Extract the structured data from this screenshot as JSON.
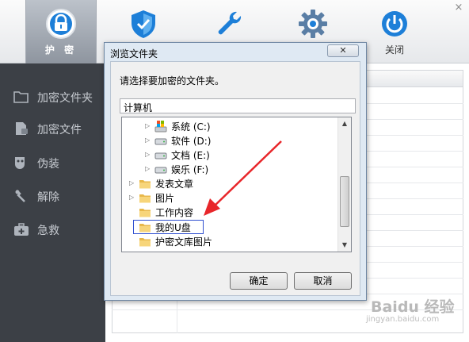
{
  "toolbar": {
    "protect_label": "护 密",
    "shield_label": "",
    "tools_label": "工具",
    "settings_label": "设置",
    "close_label": "关闭",
    "window_close": "×"
  },
  "sidebar": {
    "items": [
      {
        "label": "加密文件夹",
        "icon": "folder-icon"
      },
      {
        "label": "加密文件",
        "icon": "file-icon"
      },
      {
        "label": "伪装",
        "icon": "disguise-icon"
      },
      {
        "label": "解除",
        "icon": "unlock-icon"
      },
      {
        "label": "急救",
        "icon": "first-aid-icon"
      }
    ]
  },
  "dialog": {
    "title": "浏览文件夹",
    "close": "✕",
    "prompt": "请选择要加密的文件夹。",
    "path": "计算机",
    "tree": [
      {
        "label": "系统 (C:)",
        "icon": "system-drive-icon"
      },
      {
        "label": "软件 (D:)",
        "icon": "drive-icon"
      },
      {
        "label": "文档 (E:)",
        "icon": "drive-icon"
      },
      {
        "label": "娱乐 (F:)",
        "icon": "drive-icon"
      },
      {
        "label": "发表文章",
        "icon": "folder-icon"
      },
      {
        "label": "图片",
        "icon": "folder-icon"
      },
      {
        "label": "工作内容",
        "icon": "folder-icon"
      },
      {
        "label": "我的U盘",
        "icon": "folder-icon"
      },
      {
        "label": "护密文库图片",
        "icon": "folder-icon"
      }
    ],
    "ok_label": "确定",
    "cancel_label": "取消"
  },
  "watermark": {
    "text": "Baidu 经验",
    "sub": "jingyan.baidu.com"
  },
  "colors": {
    "sidebar_bg": "#3c4046",
    "dialog_bg": "#dfe9f3",
    "arrow": "#e8262a",
    "accent_blue": "#1d7fd8"
  }
}
